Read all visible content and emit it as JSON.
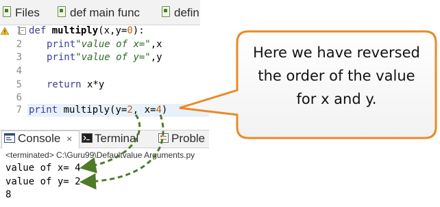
{
  "tabs": [
    {
      "label": "Files"
    },
    {
      "label": "def main func"
    },
    {
      "label": "defin"
    }
  ],
  "editor": {
    "line_numbers": [
      "1",
      "2",
      "3",
      "4",
      "5",
      "6",
      "7"
    ],
    "lines": {
      "l1_kw": "def",
      "l1_fn": "multiply",
      "l1_open": "(x,y=",
      "l1_num": "0",
      "l1_close": "):",
      "l2_a": "print",
      "l2_str": "\"value of x=\"",
      "l2_b": ",x",
      "l3_a": "print",
      "l3_str": "\"value of y=\"",
      "l3_b": ",y",
      "l5_kw": "return",
      "l5_b": " x*y",
      "l7_kw": "print",
      "l7_a": " multiply(y=",
      "l7_n1": "2",
      "l7_b": ", x=",
      "l7_n2": "4",
      "l7_c": ")"
    }
  },
  "panel": {
    "tabs": [
      {
        "label": "Console",
        "close": "×"
      },
      {
        "label": "Terminal"
      },
      {
        "label": "Proble"
      }
    ],
    "terminated_path": "<terminated> C:\\Guru99\\Defaultvalue Arguments.py",
    "output": [
      "value of x= 4",
      "value of y= 2",
      "8"
    ]
  },
  "callout": {
    "lines": [
      "Here we have reversed",
      "the order of the  value",
      "for x and y."
    ]
  },
  "colors": {
    "arrow": "#4f7a2a",
    "callout_border": "#e98a25",
    "keyword": "#3a3aa0",
    "string": "#2a6a2a"
  },
  "icons": [
    "python-file-icon",
    "warning-icon",
    "console-icon",
    "terminal-icon",
    "problems-icon"
  ]
}
